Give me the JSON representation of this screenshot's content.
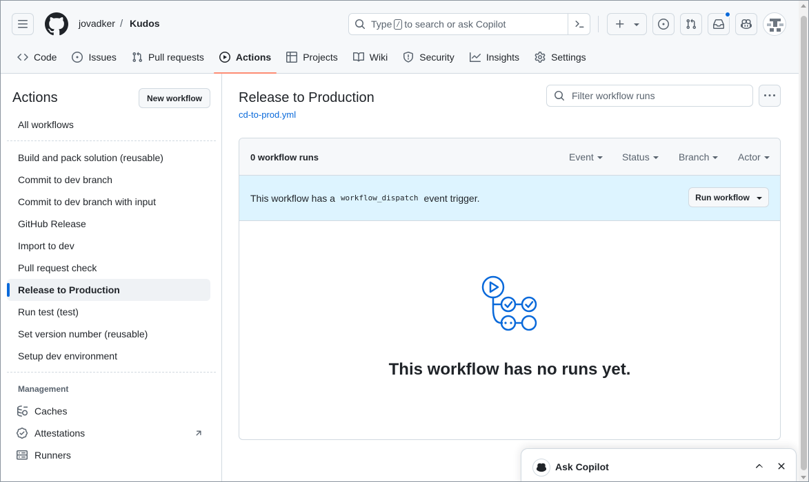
{
  "header": {
    "owner": "jovadker",
    "separator": "/",
    "repo": "Kudos",
    "search_prefix": "Type",
    "search_key": "/",
    "search_suffix": "to search or ask Copilot"
  },
  "repo_nav": [
    {
      "label": "Code",
      "icon": "code-icon"
    },
    {
      "label": "Issues",
      "icon": "issue-opened-icon"
    },
    {
      "label": "Pull requests",
      "icon": "git-pull-request-icon"
    },
    {
      "label": "Actions",
      "icon": "play-icon",
      "active": true
    },
    {
      "label": "Projects",
      "icon": "table-icon"
    },
    {
      "label": "Wiki",
      "icon": "book-icon"
    },
    {
      "label": "Security",
      "icon": "shield-icon"
    },
    {
      "label": "Insights",
      "icon": "graph-icon"
    },
    {
      "label": "Settings",
      "icon": "gear-icon"
    }
  ],
  "sidebar": {
    "title": "Actions",
    "new_workflow": "New workflow",
    "all_workflows": "All workflows",
    "workflows": [
      "Build and pack solution (reusable)",
      "Commit to dev branch",
      "Commit to dev branch with input",
      "GitHub Release",
      "Import to dev",
      "Pull request check",
      "Release to Production",
      "Run test (test)",
      "Set version number (reusable)",
      "Setup dev environment"
    ],
    "active_workflow": "Release to Production",
    "management_heading": "Management",
    "management": [
      {
        "label": "Caches",
        "icon": "cache-icon"
      },
      {
        "label": "Attestations",
        "icon": "verified-icon"
      },
      {
        "label": "Runners",
        "icon": "server-icon"
      }
    ]
  },
  "main": {
    "title": "Release to Production",
    "file": "cd-to-prod.yml",
    "filter_placeholder": "Filter workflow runs",
    "runs_count": "0 workflow runs",
    "filters": [
      "Event",
      "Status",
      "Branch",
      "Actor"
    ],
    "dispatch_prefix": "This workflow has a",
    "dispatch_code": "workflow_dispatch",
    "dispatch_suffix": "event trigger.",
    "run_workflow": "Run workflow",
    "empty_message": "This workflow has no runs yet."
  },
  "copilot": {
    "title": "Ask Copilot"
  },
  "colors": {
    "accent": "#0969da",
    "active_tab_underline": "#fd8c73",
    "dispatch_banner": "#ddf4ff"
  }
}
